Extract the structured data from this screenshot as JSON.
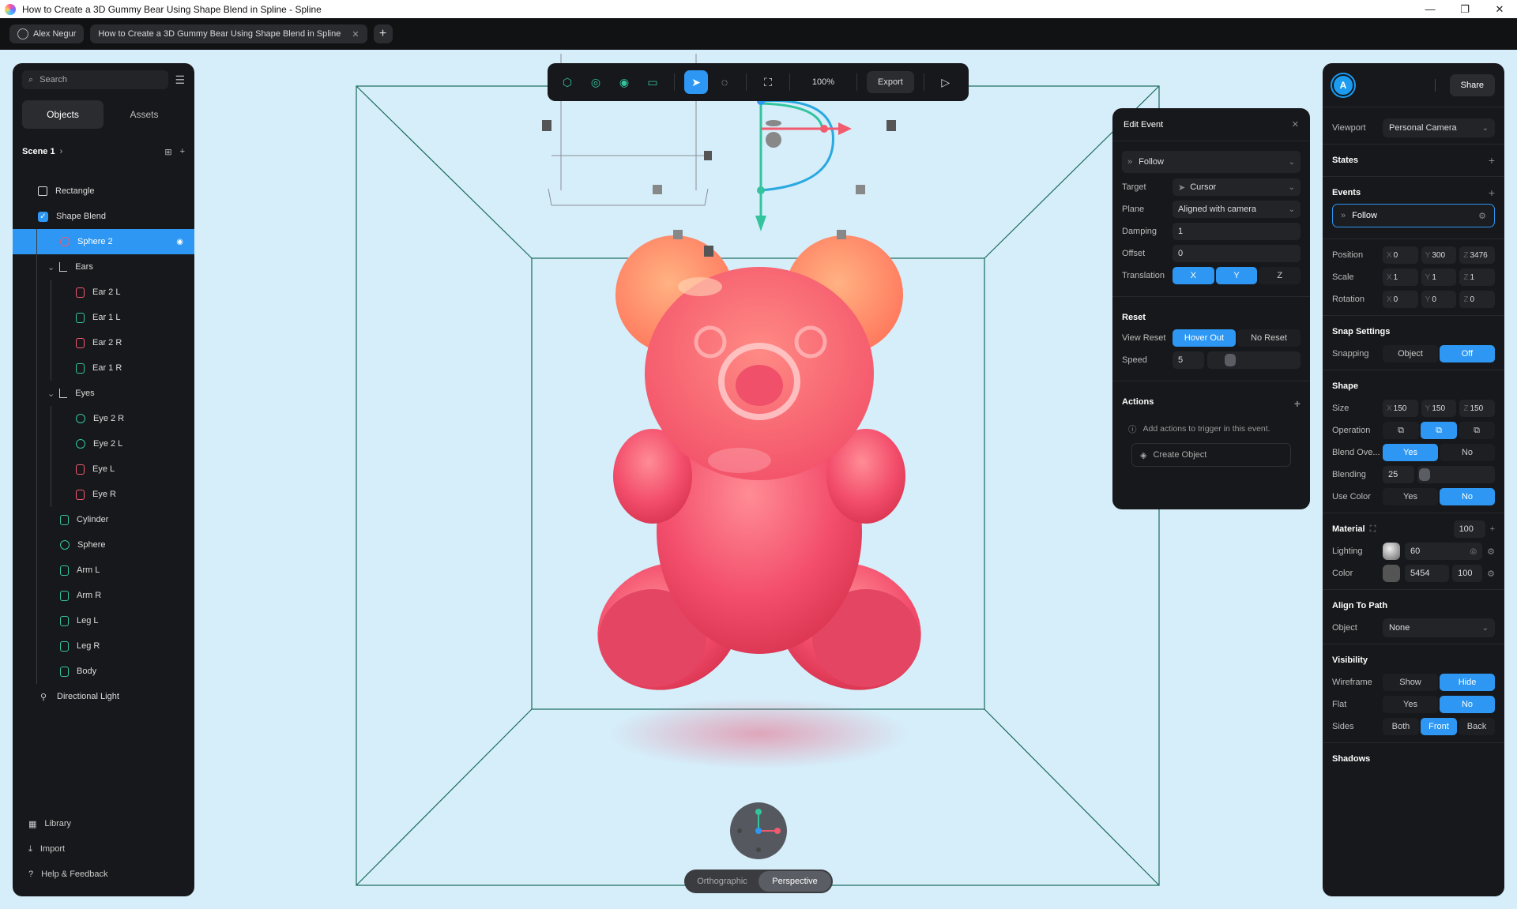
{
  "window": {
    "title": "How to Create a 3D Gummy Bear Using Shape Blend in Spline - Spline",
    "controls": [
      "—",
      "❐",
      "✕"
    ]
  },
  "tabs": {
    "user": "Alex Negur",
    "doc": "How to Create a 3D Gummy Bear Using Shape Blend in Spline",
    "add": "+"
  },
  "left": {
    "search_placeholder": "Search",
    "tab_objects": "Objects",
    "tab_assets": "Assets",
    "scene": "Scene 1",
    "tree": [
      {
        "label": "Rectangle",
        "icon": "rect",
        "depth": 0
      },
      {
        "label": "Shape Blend",
        "icon": "check",
        "depth": 0
      },
      {
        "label": "Sphere 2",
        "icon": "sph-r",
        "depth": 1,
        "selected": true
      },
      {
        "label": "Ears",
        "icon": "group",
        "depth": 1
      },
      {
        "label": "Ear 2 L",
        "icon": "cyl-r",
        "depth": 2
      },
      {
        "label": "Ear 1 L",
        "icon": "cyl-g",
        "depth": 2
      },
      {
        "label": "Ear 2 R",
        "icon": "cyl-r",
        "depth": 2
      },
      {
        "label": "Ear 1 R",
        "icon": "cyl-g",
        "depth": 2
      },
      {
        "label": "Eyes",
        "icon": "group",
        "depth": 1
      },
      {
        "label": "Eye 2 R",
        "icon": "sph-g",
        "depth": 2
      },
      {
        "label": "Eye 2 L",
        "icon": "sph-g",
        "depth": 2
      },
      {
        "label": "Eye L",
        "icon": "cyl-r",
        "depth": 2
      },
      {
        "label": "Eye R",
        "icon": "cyl-r",
        "depth": 2
      },
      {
        "label": "Cylinder",
        "icon": "cyl-g",
        "depth": 1
      },
      {
        "label": "Sphere",
        "icon": "sph-g",
        "depth": 1
      },
      {
        "label": "Arm L",
        "icon": "cyl-g",
        "depth": 1
      },
      {
        "label": "Arm R",
        "icon": "cyl-g",
        "depth": 1
      },
      {
        "label": "Leg L",
        "icon": "cyl-g",
        "depth": 1
      },
      {
        "label": "Leg R",
        "icon": "cyl-g",
        "depth": 1
      },
      {
        "label": "Body",
        "icon": "cyl-g",
        "depth": 1
      },
      {
        "label": "Directional Light",
        "icon": "light",
        "depth": 0
      }
    ],
    "footer": {
      "library": "Library",
      "import": "Import",
      "help": "Help & Feedback"
    }
  },
  "toolbar": {
    "zoom": "100%",
    "export": "Export"
  },
  "edit_event": {
    "title": "Edit Event",
    "event_type": "Follow",
    "target_label": "Target",
    "target": "Cursor",
    "plane_label": "Plane",
    "plane": "Aligned with camera",
    "damping_label": "Damping",
    "damping": "1",
    "offset_label": "Offset",
    "offset": "0",
    "translation_label": "Translation",
    "tx": "X",
    "ty": "Y",
    "tz": "Z",
    "reset_section": "Reset",
    "view_reset_label": "View Reset",
    "hover_out": "Hover Out",
    "no_reset": "No Reset",
    "speed_label": "Speed",
    "speed": "5",
    "actions_section": "Actions",
    "actions_note": "Add actions to trigger in this event.",
    "create_object": "Create Object"
  },
  "view_mode": {
    "ortho": "Orthographic",
    "persp": "Perspective"
  },
  "right": {
    "avatar": "A",
    "share": "Share",
    "viewport_label": "Viewport",
    "viewport": "Personal Camera",
    "states": "States",
    "events": "Events",
    "event_item": "Follow",
    "position_label": "Position",
    "pos": {
      "x": "0",
      "y": "300",
      "z": "3476"
    },
    "scale_label": "Scale",
    "scale": {
      "x": "1",
      "y": "1",
      "z": "1"
    },
    "rotation_label": "Rotation",
    "rot": {
      "x": "0",
      "y": "0",
      "z": "0"
    },
    "snap_section": "Snap Settings",
    "snapping_label": "Snapping",
    "snap_object": "Object",
    "snap_off": "Off",
    "shape_section": "Shape",
    "size_label": "Size",
    "size": {
      "x": "150",
      "y": "150",
      "z": "150"
    },
    "operation_label": "Operation",
    "blend_over_label": "Blend Ove...",
    "yes": "Yes",
    "no": "No",
    "blending_label": "Blending",
    "blending": "25",
    "use_color_label": "Use Color",
    "material_section": "Material",
    "material_opacity": "100",
    "lighting_label": "Lighting",
    "lighting": "60",
    "color_label": "Color",
    "color": "5454",
    "color_opacity": "100",
    "align_section": "Align To Path",
    "object_label": "Object",
    "object": "None",
    "visibility_section": "Visibility",
    "wireframe_label": "Wireframe",
    "show": "Show",
    "hide": "Hide",
    "flat_label": "Flat",
    "sides_label": "Sides",
    "both": "Both",
    "front": "Front",
    "back": "Back",
    "shadows_section": "Shadows"
  },
  "colors": {
    "accent": "#2d97f3",
    "panel": "#17181b",
    "viewport_bg": "#d5eefa",
    "green": "#33c49e",
    "red": "#f25a6e"
  }
}
